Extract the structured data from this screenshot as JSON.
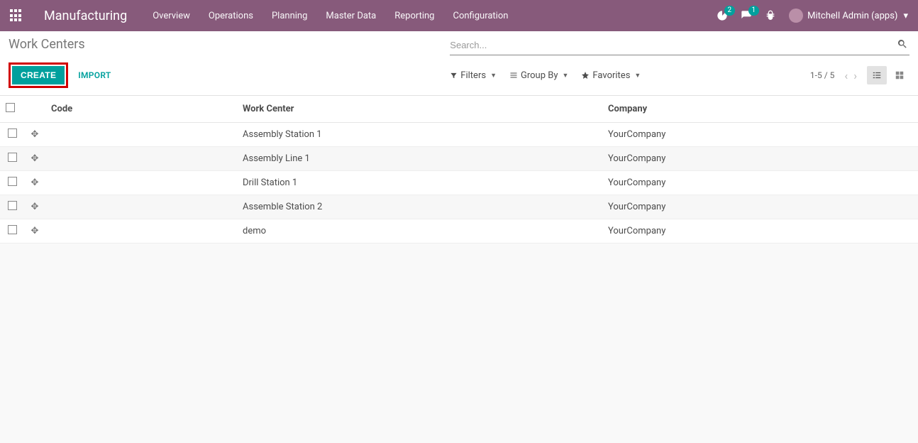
{
  "navbar": {
    "brand": "Manufacturing",
    "menu": [
      "Overview",
      "Operations",
      "Planning",
      "Master Data",
      "Reporting",
      "Configuration"
    ],
    "activity_badge": "2",
    "chat_badge": "1",
    "user_name": "Mitchell Admin (apps)"
  },
  "cp": {
    "breadcrumb": "Work Centers",
    "search_placeholder": "Search...",
    "create_label": "CREATE",
    "import_label": "IMPORT",
    "filters_label": "Filters",
    "groupby_label": "Group By",
    "favorites_label": "Favorites",
    "pager": "1-5 / 5"
  },
  "table": {
    "headers": {
      "code": "Code",
      "work_center": "Work Center",
      "company": "Company"
    },
    "rows": [
      {
        "code": "",
        "work_center": "Assembly Station 1",
        "company": "YourCompany"
      },
      {
        "code": "",
        "work_center": "Assembly Line 1",
        "company": "YourCompany"
      },
      {
        "code": "",
        "work_center": "Drill Station 1",
        "company": "YourCompany"
      },
      {
        "code": "",
        "work_center": "Assemble Station 2",
        "company": "YourCompany"
      },
      {
        "code": "",
        "work_center": "demo",
        "company": "YourCompany"
      }
    ]
  }
}
